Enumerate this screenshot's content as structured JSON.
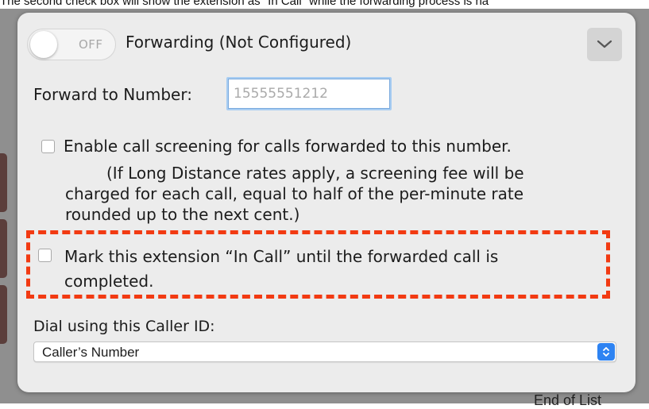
{
  "caption": "The second check box will show the extension as \"In Call\" while the forwarding process is ha",
  "toggle": {
    "label": "OFF",
    "state": "off"
  },
  "forwarding": {
    "title": "Forwarding (Not Configured)"
  },
  "forward_number": {
    "label": "Forward to Number:",
    "value": "",
    "placeholder": "15555551212"
  },
  "screening": {
    "checkbox_label": "Enable call screening for calls forwarded to this number.",
    "checked": false,
    "note_lines": [
      "(If Long Distance rates apply, a screening fee will be",
      "charged for each call, equal to half of the per-minute rate",
      "rounded up to the next cent.)"
    ]
  },
  "in_call": {
    "label_lines": [
      "Mark this extension “In Call” until the forwarded call is",
      "completed."
    ],
    "checked": false
  },
  "caller_id": {
    "label": "Dial using this Caller ID:",
    "selected": "Caller’s Number"
  },
  "footer": {
    "text": "End of List"
  },
  "colors": {
    "highlight_dash": "#f23a12",
    "select_accent": "#2e83f2",
    "input_focus": "#a8cdf2"
  },
  "icons": {
    "collapse": "chevron-down-icon",
    "select": "updown-arrows-icon"
  }
}
